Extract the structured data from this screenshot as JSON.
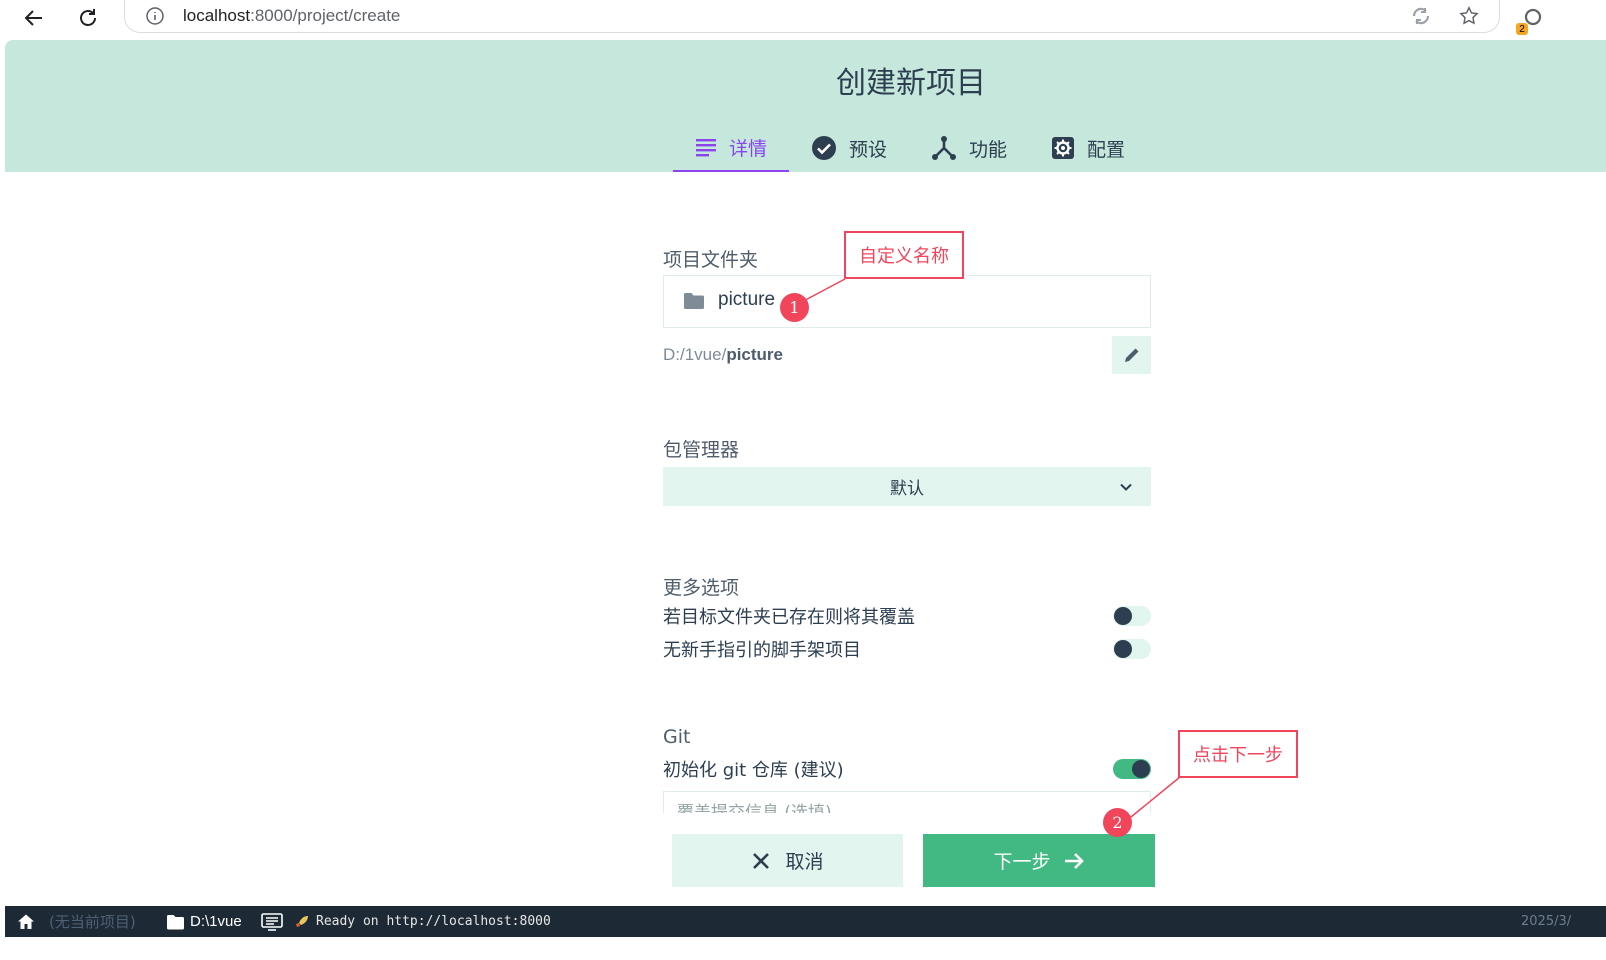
{
  "browser": {
    "url_host": "localhost",
    "url_rest": ":8000/project/create",
    "extension_badge": "2"
  },
  "page": {
    "title": "创建新项目",
    "tabs": [
      {
        "label": "详情",
        "icon": "list-icon",
        "active": true
      },
      {
        "label": "预设",
        "icon": "check-circle-icon",
        "active": false
      },
      {
        "label": "功能",
        "icon": "fork-icon",
        "active": false
      },
      {
        "label": "配置",
        "icon": "settings-icon",
        "active": false
      }
    ]
  },
  "form": {
    "folder": {
      "label": "项目文件夹",
      "value": "picture",
      "path_prefix": "D:/1vue/",
      "path_name": "picture"
    },
    "package_manager": {
      "label": "包管理器",
      "selected": "默认"
    },
    "more_options": {
      "label": "更多选项",
      "options": [
        {
          "label": "若目标文件夹已存在则将其覆盖",
          "on": false
        },
        {
          "label": "无新手指引的脚手架项目",
          "on": false
        }
      ]
    },
    "git": {
      "label": "Git",
      "init_label": "初始化 git 仓库 (建议)",
      "init_on": true,
      "commit_placeholder": "覆盖提交信息 (选填)"
    }
  },
  "actions": {
    "cancel_label": "取消",
    "next_label": "下一步"
  },
  "annotations": {
    "callout_1": "自定义名称",
    "marker_1": "1",
    "callout_2": "点击下一步",
    "marker_2": "2"
  },
  "status_bar": {
    "project": "(无当前项目)",
    "folder": "D:\\1vue",
    "log": "Ready on http://localhost:8000",
    "date": "2025/3/"
  },
  "colors": {
    "header_bg": "#c6e8dc",
    "accent_green": "#42b983",
    "tab_active": "#8b45ef",
    "annotation_red": "#f0455a",
    "status_bar_bg": "#1d2935"
  }
}
